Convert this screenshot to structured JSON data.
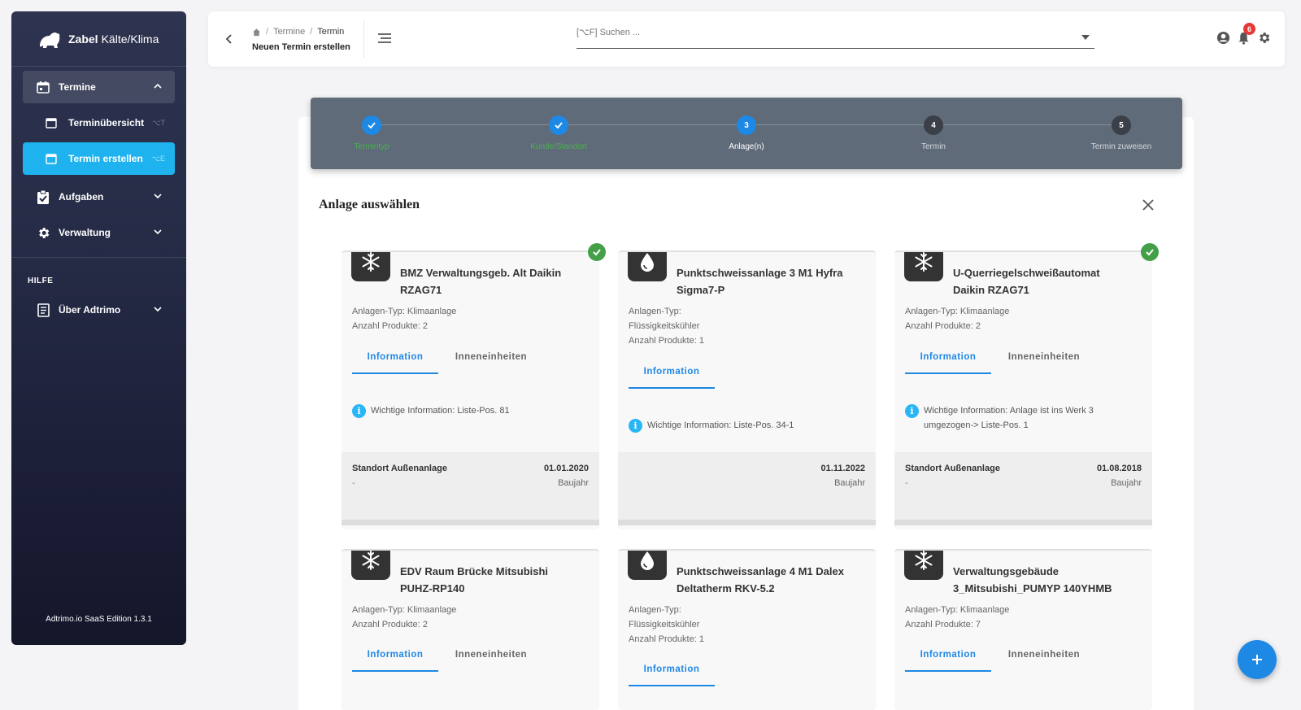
{
  "brand": {
    "name_bold": "Zabel",
    "name_rest": "Kälte/Klima"
  },
  "sidebar": {
    "termine": {
      "label": "Termine"
    },
    "terminuebersicht": {
      "label": "Terminübersicht",
      "shortcut": "⌥T"
    },
    "termin_erstellen": {
      "label": "Termin erstellen",
      "shortcut": "⌥E"
    },
    "aufgaben": {
      "label": "Aufgaben"
    },
    "verwaltung": {
      "label": "Verwaltung"
    },
    "hilfe_header": "HILFE",
    "ueber": {
      "label": "Über Adtrimo"
    },
    "version": "Adtrimo.io SaaS Edition 1.3.1"
  },
  "topbar": {
    "breadcrumb": [
      "Termine",
      "Termin"
    ],
    "subtitle": "Neuen Termin erstellen",
    "search_placeholder": "[⌥F] Suchen ...",
    "notification_count": "6"
  },
  "stepper": {
    "steps": [
      {
        "num": "",
        "label": "Termintyp",
        "state": "done"
      },
      {
        "num": "",
        "label": "Kunde/Standort",
        "state": "done"
      },
      {
        "num": "3",
        "label": "Anlage(n)",
        "state": "current"
      },
      {
        "num": "4",
        "label": "Termin",
        "state": "todo"
      },
      {
        "num": "5",
        "label": "Termin zuweisen",
        "state": "todo"
      }
    ]
  },
  "section": {
    "title": "Anlage auswählen"
  },
  "cards": [
    {
      "title": "BMZ Verwaltungsgeb. Alt Daikin RZAG71",
      "icon": "snowflake-icon",
      "meta": [
        "Anlagen-Typ: Klimaanlage",
        "Anzahl Produkte: 2"
      ],
      "tab_info": "Information",
      "tab_inner": "Inneneinheiten",
      "info": "Wichtige Information: Liste-Pos. 81",
      "location": "Standort Außenanlage",
      "location_value": "-",
      "date": "01.01.2020",
      "date_label": "Baujahr",
      "selected": true
    },
    {
      "title": "Punktschweissanlage 3 M1 Hyfra Sigma7-P",
      "icon": "water-drop-icon",
      "meta": [
        "Anlagen-Typ:",
        "Flüssigkeitskühler",
        "Anzahl Produkte: 1"
      ],
      "tab_info": "Information",
      "info": "Wichtige Information: Liste-Pos. 34-1",
      "date": "01.11.2022",
      "date_label": "Baujahr",
      "selected": false
    },
    {
      "title": "U-Querriegelschweißautomat Daikin RZAG71",
      "icon": "snowflake-icon",
      "meta": [
        "Anlagen-Typ: Klimaanlage",
        "Anzahl Produkte: 2"
      ],
      "tab_info": "Information",
      "tab_inner": "Inneneinheiten",
      "info": "Wichtige Information: Anlage ist ins Werk 3 umgezogen-> Liste-Pos. 1",
      "location": "Standort Außenanlage",
      "location_value": "-",
      "date": "01.08.2018",
      "date_label": "Baujahr",
      "selected": true
    },
    {
      "title": "EDV Raum Brücke Mitsubishi PUHZ-RP140",
      "icon": "snowflake-icon",
      "meta": [
        "Anlagen-Typ: Klimaanlage",
        "Anzahl Produkte: 2"
      ],
      "tab_info": "Information",
      "tab_inner": "Inneneinheiten"
    },
    {
      "title": "Punktschweissanlage 4 M1 Dalex Deltatherm RKV-5.2",
      "icon": "water-drop-icon",
      "meta": [
        "Anlagen-Typ:",
        "Flüssigkeitskühler",
        "Anzahl Produkte: 1"
      ],
      "tab_info": "Information"
    },
    {
      "title": "Verwaltungsgebäude 3_Mitsubishi_PUMYP 140YHMB",
      "icon": "snowflake-icon",
      "meta": [
        "Anlagen-Typ: Klimaanlage",
        "Anzahl Produkte: 7"
      ],
      "tab_info": "Information",
      "tab_inner": "Inneneinheiten"
    }
  ],
  "colors": {
    "accent": "#1e88e5",
    "active_nav": "#1eb3ee",
    "success": "#43a047",
    "sidebar_top": "#2e3450"
  }
}
